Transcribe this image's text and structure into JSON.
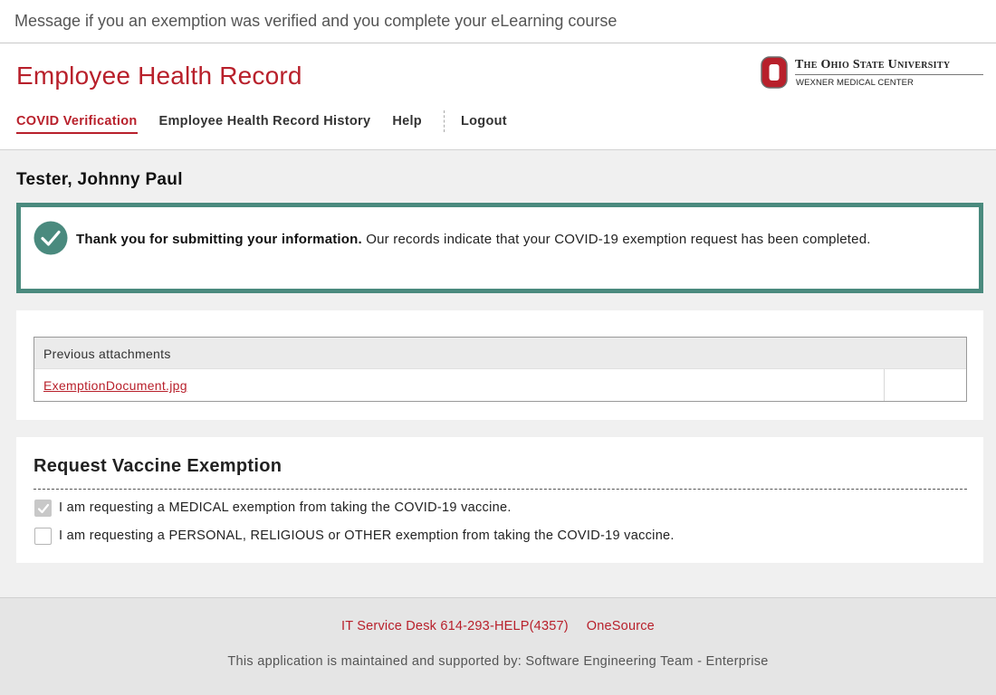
{
  "caption": "Message if you an exemption was verified and you complete your eLearning course",
  "header": {
    "app_title": "Employee Health Record",
    "logo": {
      "university": "The Ohio State University",
      "center": "WEXNER MEDICAL CENTER",
      "icon": "block-o-logo"
    },
    "nav": {
      "covid": "COVID Verification",
      "history": "Employee Health Record History",
      "help": "Help",
      "logout": "Logout"
    }
  },
  "user": {
    "name": "Tester, Johnny Paul"
  },
  "alert": {
    "icon": "check-circle-icon",
    "bold": "Thank you for submitting your information.",
    "text": " Our records indicate that your COVID-19 exemption request has been completed."
  },
  "attachments": {
    "header": "Previous attachments",
    "files": [
      "ExemptionDocument.jpg"
    ]
  },
  "exemption": {
    "title": "Request Vaccine Exemption",
    "options": [
      {
        "label": "I am requesting a MEDICAL exemption from taking the COVID-19 vaccine.",
        "checked": true
      },
      {
        "label": "I am requesting a PERSONAL, RELIGIOUS or OTHER exemption from taking the COVID-19 vaccine.",
        "checked": false
      }
    ]
  },
  "footer": {
    "service_desk": "IT Service Desk 614-293-HELP(4357)",
    "onesource": "OneSource",
    "note": "This application is maintained and supported by: Software Engineering Team - Enterprise"
  },
  "colors": {
    "brand": "#b8202b",
    "success": "#4a8a7e",
    "checkbox_disabled": "#c8c8c8"
  }
}
